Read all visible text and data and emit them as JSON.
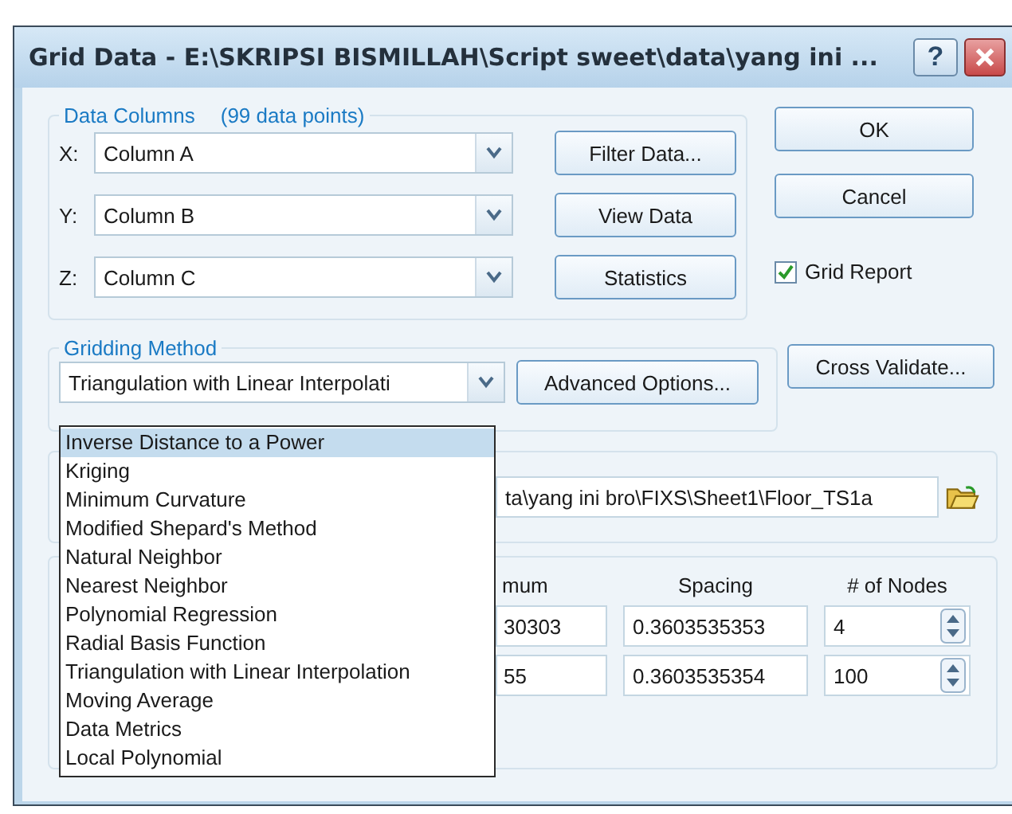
{
  "window": {
    "title": "Grid Data - E:\\SKRIPSI BISMILLAH\\Script sweet\\data\\yang ini ...",
    "help_button": "?"
  },
  "data_columns": {
    "label": "Data Columns",
    "count": "(99 data points)",
    "rows": [
      {
        "axis": "X:",
        "value": "Column A",
        "button": "Filter Data..."
      },
      {
        "axis": "Y:",
        "value": "Column B",
        "button": "View Data"
      },
      {
        "axis": "Z:",
        "value": "Column C",
        "button": "Statistics"
      }
    ]
  },
  "buttons": [
    "OK",
    "Cancel"
  ],
  "grid_report": {
    "label": "Grid Report",
    "checked": true
  },
  "gridding_method": {
    "label": "Gridding Method",
    "value": "Triangulation with Linear Interpolati",
    "buttons": [
      "Advanced Options...",
      "Cross Validate..."
    ],
    "dropdown": [
      {
        "label": "Inverse Distance to a Power",
        "selected": true
      },
      {
        "label": "Kriging",
        "selected": false
      },
      {
        "label": "Minimum Curvature",
        "selected": false
      },
      {
        "label": "Modified Shepard's Method",
        "selected": false
      },
      {
        "label": "Natural Neighbor",
        "selected": false
      },
      {
        "label": "Nearest Neighbor",
        "selected": false
      },
      {
        "label": "Polynomial Regression",
        "selected": false
      },
      {
        "label": "Radial Basis Function",
        "selected": false
      },
      {
        "label": "Triangulation with Linear Interpolation",
        "selected": false
      },
      {
        "label": "Moving Average",
        "selected": false
      },
      {
        "label": "Data Metrics",
        "selected": false
      },
      {
        "label": "Local Polynomial",
        "selected": false
      }
    ]
  },
  "output_file": {
    "path": "ta\\yang ini bro\\FIXS\\Sheet1\\Floor_TS1a"
  },
  "geometry": {
    "columns": [
      "mum",
      "Spacing",
      "# of Nodes"
    ],
    "rows": [
      [
        "30303",
        "0.3603535353",
        "4"
      ],
      [
        "55",
        "0.3603535354",
        "100"
      ]
    ]
  }
}
